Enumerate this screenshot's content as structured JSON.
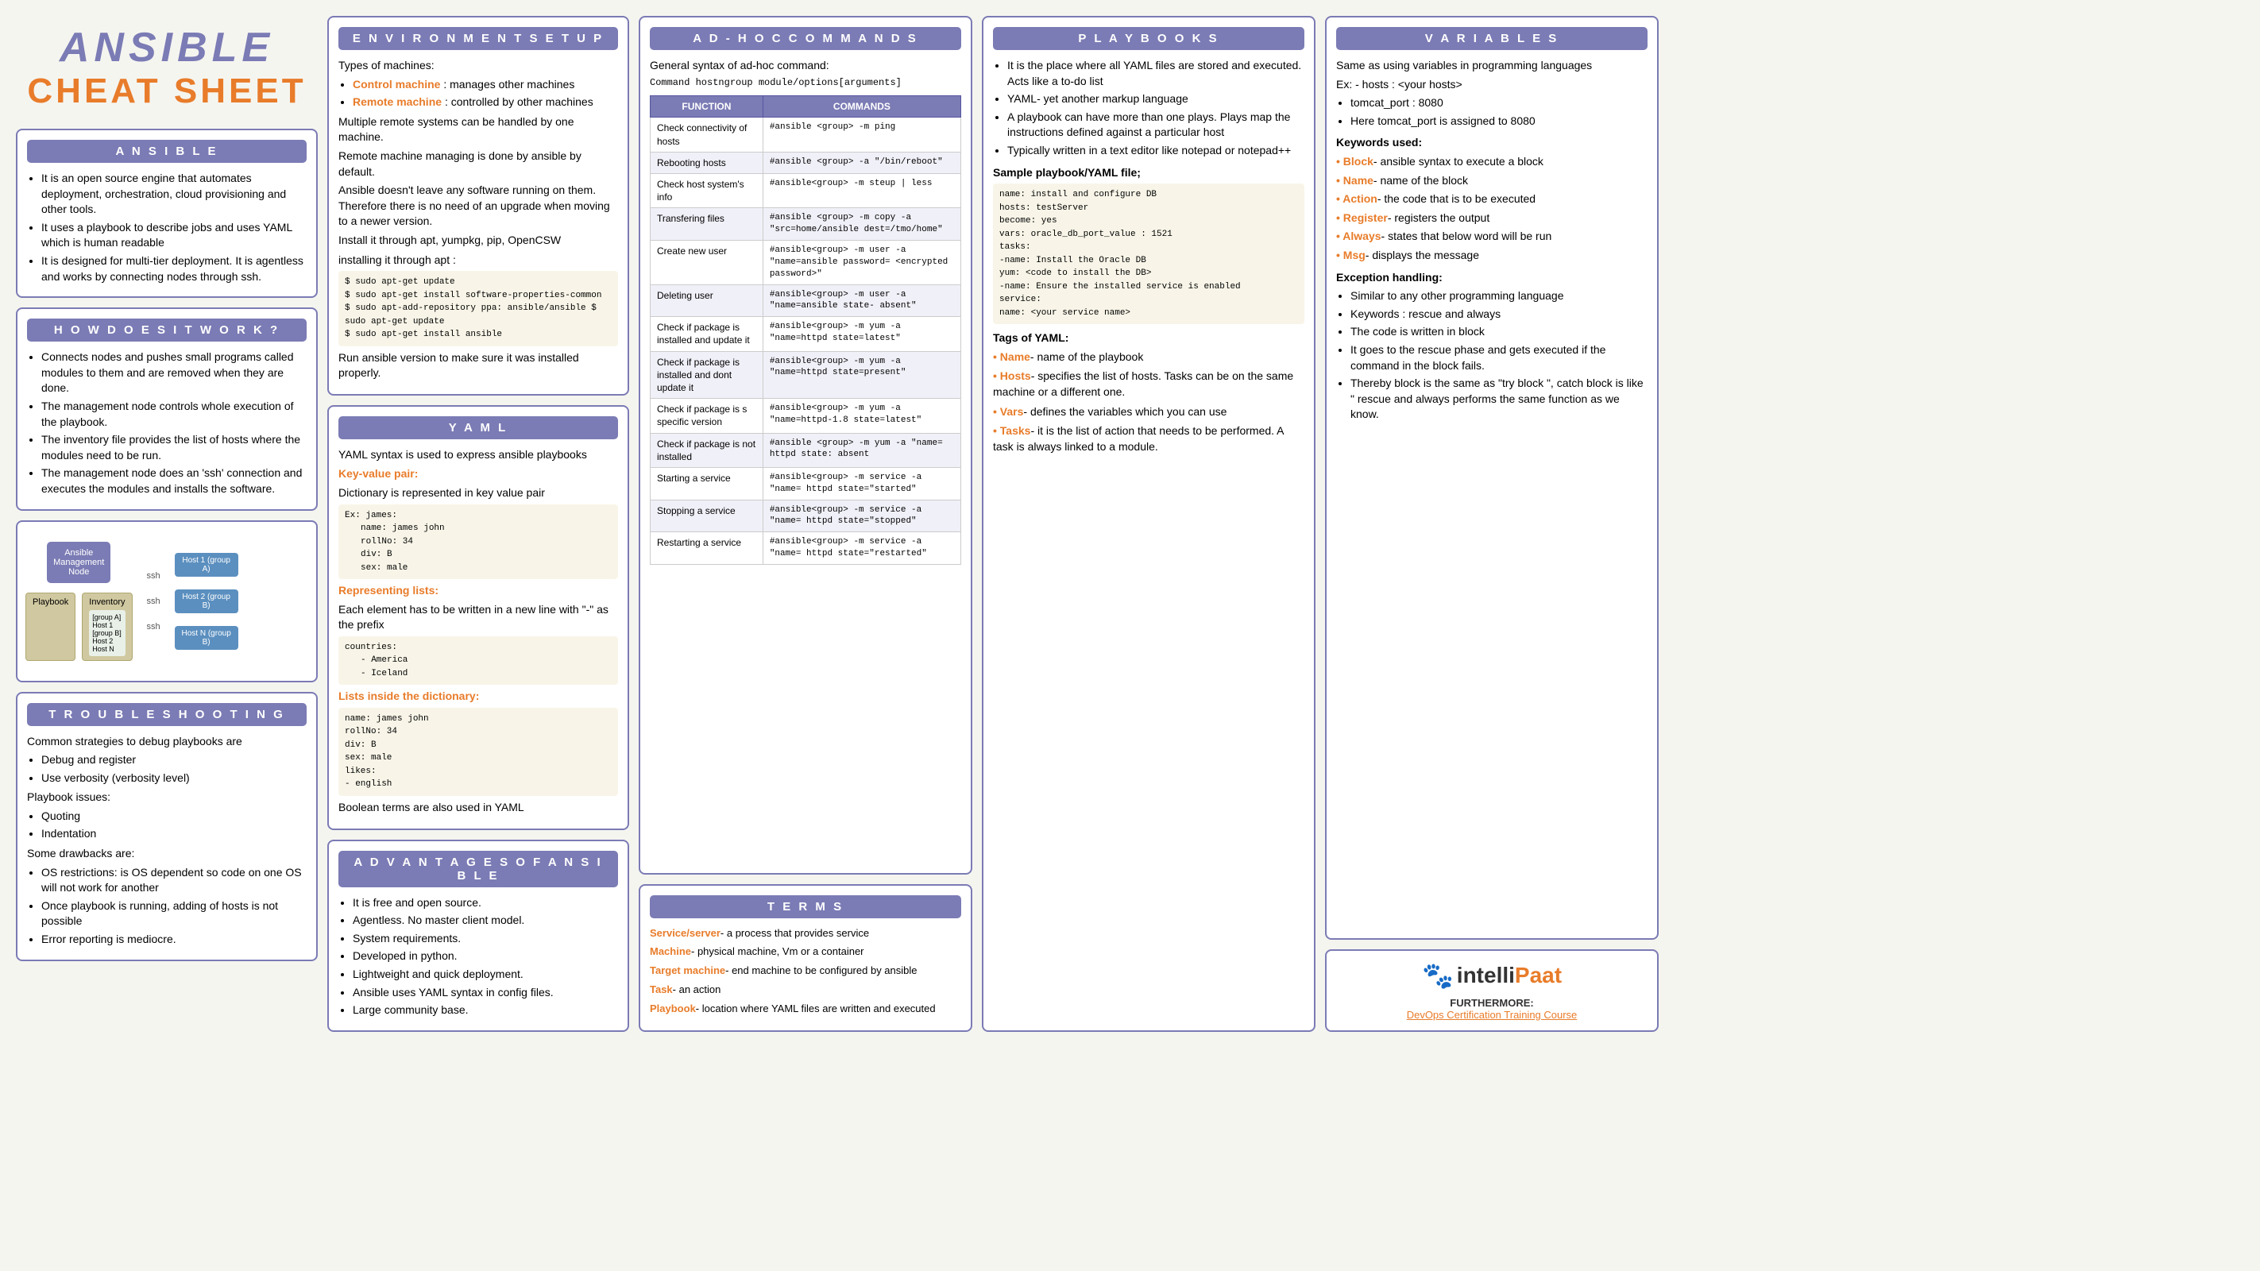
{
  "title": {
    "ansible": "ANSIBLE",
    "cheatsheet": "CHEAT SHEET"
  },
  "ansible_section": {
    "header": "A n s i b l e",
    "points": [
      "It is an open source engine that automates deployment, orchestration, cloud provisioning and other tools.",
      "It uses a playbook to describe jobs and uses YAML which is human readable",
      "It is designed for multi-tier deployment. It is agentless and works by connecting nodes through ssh."
    ]
  },
  "how_works": {
    "header": "H o w   D o e s   i t   W o r k ?",
    "points": [
      "Connects nodes and pushes small programs called modules to them and are removed when they are done.",
      "The management node controls whole execution of the playbook.",
      "The inventory file provides the list of hosts where the modules need to be run.",
      "The management node does an 'ssh' connection and executes the modules and installs the software."
    ]
  },
  "diagram": {
    "mgmt_label": "Ansible Management Node",
    "ssh1": "ssh",
    "ssh2": "ssh",
    "ssh3": "ssh",
    "host1": "Host 1 (group A)",
    "host2": "Host 2 (group B)",
    "hostn": "Host N (group B)",
    "playbook": "Playbook",
    "inventory": "Inventory",
    "inv_detail": "[group A]\nHost 1\n[group B]\nHost 2\nHost N"
  },
  "troubleshooting": {
    "header": "T r o u b l e s h o o t i n g",
    "strategies_label": "Common strategies to debug playbooks are",
    "strategies": [
      "Debug and register",
      "Use verbosity (verbosity level)"
    ],
    "playbook_issues_label": "Playbook issues:",
    "playbook_issues": [
      "Quoting",
      "Indentation"
    ],
    "drawbacks_label": "Some drawbacks are:",
    "drawbacks": [
      "OS restrictions: is OS dependent so code on one OS will not work for another",
      "Once playbook is running, adding of hosts is not possible",
      "Error reporting is mediocre."
    ]
  },
  "env_setup": {
    "header": "E n v i r o n m e n t   S e t u p",
    "types_label": "Types of machines:",
    "control_machine": "Control machine",
    "control_desc": ": manages other machines",
    "remote_machine": "Remote machine",
    "remote_desc": ": controlled by other machines",
    "points": [
      "Multiple remote systems can be handled by one machine.",
      "Remote machine managing is done by ansible by default.",
      "Ansible doesn't leave any software running on them. Therefore there is no need of an upgrade when moving to a newer version.",
      "Install it through apt, yumpkg, pip, OpenCSW"
    ],
    "install_apt_label": "installing it through apt :",
    "install_steps": [
      "$ sudo apt-get update",
      "$ sudo apt-get install software-properties-common",
      "$ sudo apt-add-repository ppa: ansible/ansible $ sudo apt-get update",
      "$ sudo apt-get install ansible"
    ],
    "run_label": "Run ansible version to make sure it was installed properly."
  },
  "yaml": {
    "header": "Y A M L",
    "intro": "YAML syntax is used to express ansible playbooks",
    "kv_label": "Key-value pair:",
    "kv_desc": "Dictionary is represented in key value pair",
    "kv_ex_label": "Ex: james:",
    "kv_items": [
      "name: james john",
      "rollNo: 34",
      "div: B",
      "sex: male"
    ],
    "repr_lists_label": "Representing lists:",
    "repr_lists_desc": "Each element has to be written in a new line with \"-\" as the prefix",
    "countries_label": "countries:",
    "countries": [
      "- America",
      "- Iceland"
    ],
    "list_in_dict_label": "Lists inside the dictionary:",
    "list_in_dict": [
      "name: james john",
      "rollNo: 34",
      "div: B",
      "sex: male",
      "likes:",
      "  - english"
    ],
    "boolean_label": "Boolean terms are also used in YAML"
  },
  "advantages": {
    "header": "A d v a n t a g e s   o f   A n s i b l e",
    "points": [
      "It is free and open source.",
      "Agentless. No master client model.",
      "System requirements.",
      "Developed in python.",
      "Lightweight and quick deployment.",
      "Ansible uses YAML syntax in config files.",
      "Large community base."
    ]
  },
  "adhoc": {
    "header": "A d - h o c   C o m m a n d s",
    "syntax_label": "General syntax of ad-hoc command:",
    "syntax": "Command hostngroup module/options[arguments]",
    "col_function": "FUNCTION",
    "col_commands": "COMMANDS",
    "rows": [
      {
        "function": "Check connectivity of hosts",
        "command": "#ansible <group> -m ping"
      },
      {
        "function": "Rebooting hosts",
        "command": "#ansible <group> -a \"/bin/reboot\""
      },
      {
        "function": "Check host system's info",
        "command": "#ansible<group> -m steup | less"
      },
      {
        "function": "Transfering files",
        "command": "#ansible <group> -m copy -a \"src=home/ansible dest=/tmo/home\""
      },
      {
        "function": "Create new user",
        "command": "#ansible<group> -m user -a \"name=ansible password= <encrypted password>\""
      },
      {
        "function": "Deleting user",
        "command": "#ansible<group> -m user -a \"name=ansible state- absent\""
      },
      {
        "function": "Check if package is installed and update it",
        "command": "#ansible<group> -m yum -a \"name=httpd state=latest\""
      },
      {
        "function": "Check if package is installed and dont update it",
        "command": "#ansible<group> -m yum -a \"name=httpd state=present\""
      },
      {
        "function": "Check if package is s specific version",
        "command": "#ansible<group> -m yum -a \"name=httpd-1.8 state=latest\""
      },
      {
        "function": "Check if package is not installed",
        "command": "#ansible <group> -m yum -a \"name= httpd state: absent"
      },
      {
        "function": "Starting a service",
        "command": "#ansible<group> -m service -a \"name= httpd state=\"started\""
      },
      {
        "function": "Stopping a service",
        "command": "#ansible<group> -m service -a \"name= httpd state=\"stopped\""
      },
      {
        "function": "Restarting a service",
        "command": "#ansible<group> -m service -a \"name= httpd state=\"restarted\""
      }
    ]
  },
  "terms": {
    "header": "T e r m s",
    "items": [
      {
        "term": "Service/server",
        "desc": "- a process that provides service",
        "color": "orange"
      },
      {
        "term": "Machine",
        "desc": "- physical machine, Vm or a container",
        "color": "orange"
      },
      {
        "term": "Target machine",
        "desc": "- end machine to be configured by ansible",
        "color": "orange"
      },
      {
        "term": "Task",
        "desc": "- an action",
        "color": "orange"
      },
      {
        "term": "Playbook",
        "desc": "- location where YAML files are written and executed",
        "color": "orange"
      }
    ]
  },
  "playbooks": {
    "header": "P l a y b o o k s",
    "points": [
      "It is the place where all YAML files are stored and executed. Acts like a to-do list",
      "YAML- yet another markup language",
      "A playbook can have more than one plays. Plays map the instructions defined against a particular host",
      "Typically written in a text editor like notepad or notepad++"
    ],
    "sample_label": "Sample playbook/YAML file;",
    "sample_code": "name: install and configure DB\nhosts: testServer\nbecome: yes\nvars: oracle_db_port_value : 1521\ntasks:\n  -name: Install the Oracle DB\n  yum: <code to install the DB>\n  -name: Ensure the installed service is enabled\n  service:\n    name: <your service name>",
    "tags_label": "Tags of YAML:",
    "tags": [
      {
        "tag": "Name",
        "desc": "- name of the playbook",
        "color": "orange"
      },
      {
        "tag": "Hosts",
        "desc": "- specifies the list of hosts. Tasks can be on the same machine or a different one.",
        "color": "orange"
      },
      {
        "tag": "Vars",
        "desc": "- defines the variables which you can use",
        "color": "orange"
      },
      {
        "tag": "Tasks",
        "desc": "- it is the list of action that needs to be performed. A task is always linked to a module.",
        "color": "orange"
      }
    ]
  },
  "variables": {
    "header": "V a r i a b l e s",
    "intro": "Same as using variables in programming languages",
    "ex_label": "Ex: - hosts : <your hosts>",
    "ex_items": [
      "tomcat_port : 8080",
      "Here tomcat_port is assigned to 8080"
    ],
    "keywords_label": "Keywords used:",
    "keywords": [
      {
        "kw": "Block",
        "desc": "- ansible syntax to execute a block",
        "color": "orange"
      },
      {
        "kw": "Name",
        "desc": "- name of the block",
        "color": "orange"
      },
      {
        "kw": "Action",
        "desc": "- the code that is to be executed",
        "color": "orange"
      },
      {
        "kw": "Register",
        "desc": "- registers the output",
        "color": "orange"
      },
      {
        "kw": "Always",
        "desc": "- states that below word will be run",
        "color": "orange"
      },
      {
        "kw": "Msg",
        "desc": "- displays the message",
        "color": "orange"
      }
    ],
    "exception_label": "Exception handling:",
    "exception_points": [
      "Similar to any other programming language",
      "Keywords : rescue and always",
      "The code is written in block",
      "It goes to the rescue phase and gets executed if the command in the block fails.",
      "Thereby block is the same as \"try block \", catch block is like \" rescue and always performs the same function as we know."
    ]
  },
  "logo": {
    "intelli": "intelli",
    "paat": "Paat",
    "furthermore": "FURTHERMORE:",
    "devops": "DevOps Certification Training Course"
  }
}
